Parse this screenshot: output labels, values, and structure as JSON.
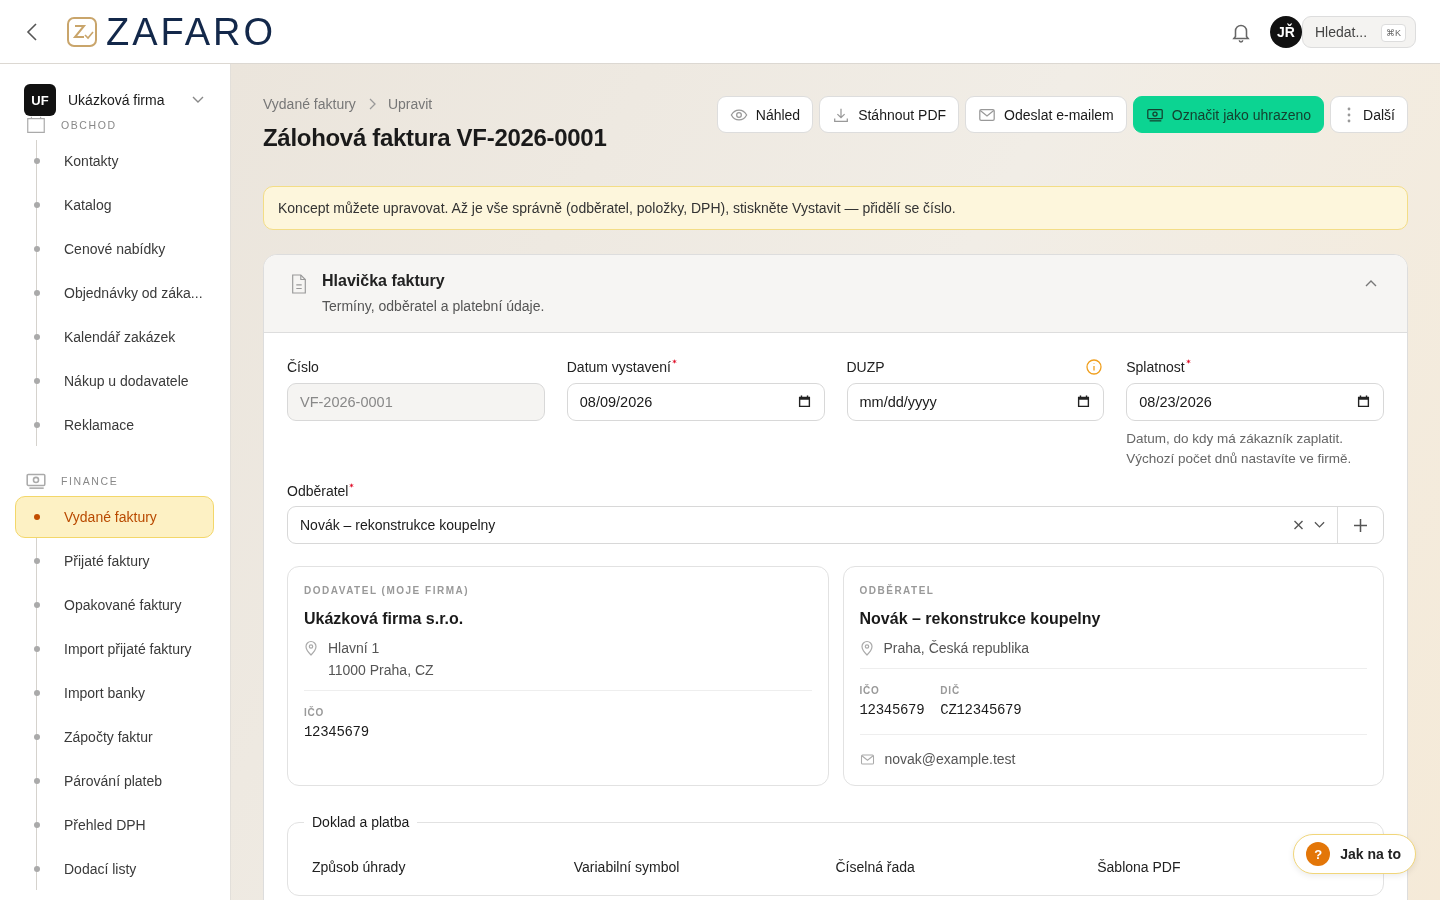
{
  "header": {
    "logo": "ZAFARO",
    "avatar": "JŘ",
    "search": {
      "placeholder": "Hledat...",
      "shortcut": "⌘K"
    }
  },
  "sidebar": {
    "company": {
      "initials": "UF",
      "name": "Ukázková firma"
    },
    "sections": [
      {
        "title": "OBCHOD",
        "kind": "bag",
        "items": [
          {
            "label": "Kontakty",
            "selected": false
          },
          {
            "label": "Katalog",
            "selected": false
          },
          {
            "label": "Cenové nabídky",
            "selected": false
          },
          {
            "label": "Objednávky od záka...",
            "selected": false
          },
          {
            "label": "Kalendář zakázek",
            "selected": false
          },
          {
            "label": "Nákup u dodavatele",
            "selected": false
          },
          {
            "label": "Reklamace",
            "selected": false
          }
        ]
      },
      {
        "title": "FINANCE",
        "kind": "cash",
        "items": [
          {
            "label": "Vydané faktury",
            "selected": true
          },
          {
            "label": "Přijaté faktury",
            "selected": false
          },
          {
            "label": "Opakované faktury",
            "selected": false
          },
          {
            "label": "Import přijaté faktury",
            "selected": false
          },
          {
            "label": "Import banky",
            "selected": false
          },
          {
            "label": "Zápočty faktur",
            "selected": false
          },
          {
            "label": "Párování plateb",
            "selected": false
          },
          {
            "label": "Přehled DPH",
            "selected": false
          },
          {
            "label": "Dodací listy",
            "selected": false
          }
        ]
      }
    ]
  },
  "breadcrumb": [
    "Vydané faktury",
    "Upravit"
  ],
  "title": "Zálohová faktura VF-2026-0001",
  "actions": [
    {
      "label": "Náhled",
      "kind": "eye",
      "primary": false
    },
    {
      "label": "Stáhnout PDF",
      "kind": "download",
      "primary": false
    },
    {
      "label": "Odeslat e-mailem",
      "kind": "mail",
      "primary": false
    },
    {
      "label": "Označit jako uhrazeno",
      "kind": "cash",
      "primary": true
    },
    {
      "label": "Další",
      "kind": "dots",
      "primary": false
    }
  ],
  "notice": "Koncept můžete upravovat. Až je vše správně (odběratel, položky, DPH), stiskněte Vystavit — přidělí se číslo.",
  "section": {
    "title": "Hlavička faktury",
    "subtitle": "Termíny, odběratel a platební údaje.",
    "expanded": true
  },
  "fields": [
    {
      "label": "Číslo",
      "required": false,
      "kind": "text",
      "value": "VF-2026-0001",
      "disabled": true
    },
    {
      "label": "Datum vystavení",
      "required": true,
      "kind": "date",
      "value": "08/09/2026",
      "disabled": false
    },
    {
      "label": "DUZP",
      "required": false,
      "info": true,
      "kind": "date",
      "placeholder": "mm/dd/yyyy",
      "disabled": false
    },
    {
      "label": "Splatnost",
      "required": true,
      "kind": "date",
      "value": "08/23/2026",
      "disabled": false,
      "hint": "Datum, do kdy má zákazník zaplatit. Výchozí počet dnů nastavíte ve firmě."
    }
  ],
  "customer_field": {
    "label": "Odběratel",
    "required": true,
    "value": "Novák – rekonstrukce koupelny"
  },
  "parties": [
    {
      "heading": "DODAVATEL (MOJE FIRMA)",
      "name": "Ukázková firma s.r.o.",
      "address": [
        "Hlavní 1",
        "11000 Praha, CZ"
      ],
      "ids": [
        {
          "label": "IČO",
          "value": "12345679"
        }
      ]
    },
    {
      "heading": "ODBĚRATEL",
      "name": "Novák – rekonstrukce koupelny",
      "address": [
        "Praha, Česká republika"
      ],
      "ids": [
        {
          "label": "IČO",
          "value": "12345679"
        },
        {
          "label": "DIČ",
          "value": "CZ12345679"
        }
      ],
      "email": "novak@example.test"
    }
  ],
  "payment": {
    "legend": "Doklad a platba",
    "columns": [
      "Způsob úhrady",
      "Variabilní symbol",
      "Číselná řada",
      "Šablona PDF"
    ]
  },
  "help": {
    "label": "Jak na to",
    "icon": "?"
  }
}
